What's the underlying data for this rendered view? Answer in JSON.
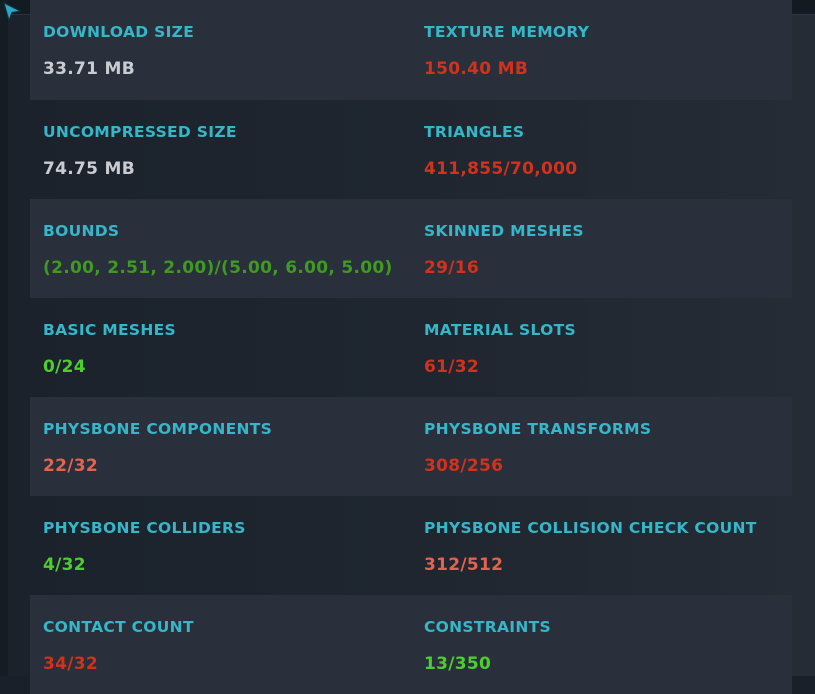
{
  "colors": {
    "label": "#35b6c9",
    "neutral": "#c9ccd1",
    "red": "#d2311c",
    "salmon": "#e2644e",
    "green": "#4ccf2d",
    "dark_green": "#3f9a22"
  },
  "cursor_icon": "pointer-arrow-icon",
  "stats": [
    {
      "left": {
        "label": "DOWNLOAD SIZE",
        "value": "33.71 MB",
        "status": "neutral"
      },
      "right": {
        "label": "TEXTURE MEMORY",
        "value": "150.40 MB",
        "status": "red"
      }
    },
    {
      "left": {
        "label": "UNCOMPRESSED SIZE",
        "value": "74.75 MB",
        "status": "neutral"
      },
      "right": {
        "label": "TRIANGLES",
        "value": "411,855/70,000",
        "status": "red"
      }
    },
    {
      "left": {
        "label": "BOUNDS",
        "value": "(2.00, 2.51, 2.00)/(5.00, 6.00, 5.00)",
        "status": "dark_green"
      },
      "right": {
        "label": "SKINNED MESHES",
        "value": "29/16",
        "status": "red"
      }
    },
    {
      "left": {
        "label": "BASIC MESHES",
        "value": "0/24",
        "status": "green"
      },
      "right": {
        "label": "MATERIAL SLOTS",
        "value": "61/32",
        "status": "red"
      }
    },
    {
      "left": {
        "label": "PHYSBONE COMPONENTS",
        "value": "22/32",
        "status": "salmon"
      },
      "right": {
        "label": "PHYSBONE TRANSFORMS",
        "value": "308/256",
        "status": "red"
      }
    },
    {
      "left": {
        "label": "PHYSBONE COLLIDERS",
        "value": "4/32",
        "status": "green"
      },
      "right": {
        "label": "PHYSBONE COLLISION CHECK COUNT",
        "value": "312/512",
        "status": "salmon"
      }
    },
    {
      "left": {
        "label": "CONTACT COUNT",
        "value": "34/32",
        "status": "red"
      },
      "right": {
        "label": "CONSTRAINTS",
        "value": "13/350",
        "status": "green"
      }
    }
  ]
}
